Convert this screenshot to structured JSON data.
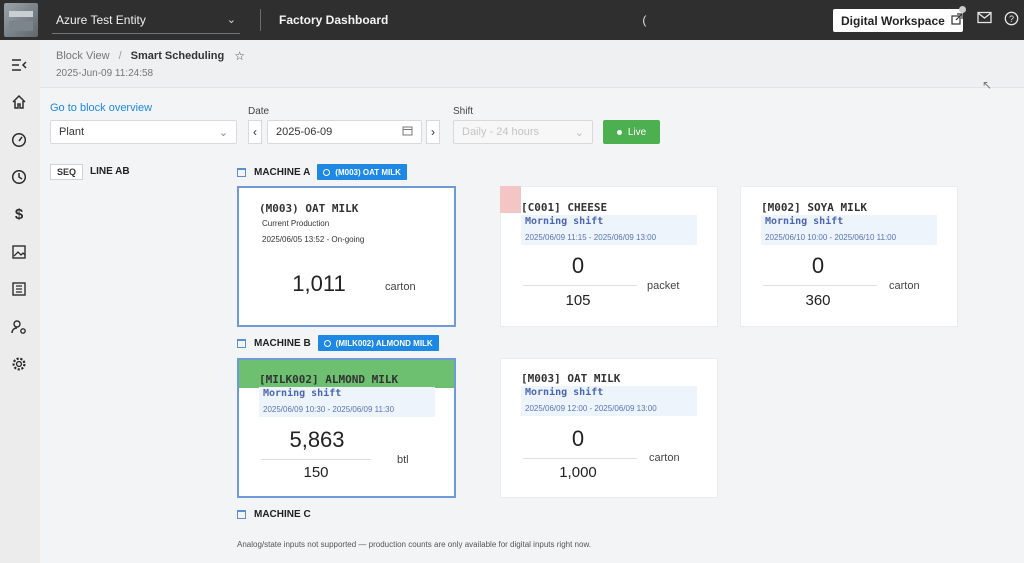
{
  "topbar": {
    "entity": "Azure Test Entity",
    "app_title": "Factory Dashboard",
    "stray_char": "(",
    "digital_workspace": "Digital Workspace"
  },
  "icons": {
    "sidebar": [
      "menu-collapse-icon",
      "home-icon",
      "speedometer-icon",
      "clock-icon",
      "dollar-icon",
      "image-icon",
      "report-icon",
      "user-settings-icon",
      "gear-icon"
    ]
  },
  "header": {
    "crumb_parent": "Block View",
    "crumb_separator": "/",
    "crumb_current": "Smart Scheduling",
    "timestamp": "2025-Jun-09 11:24:58"
  },
  "filters": {
    "block_link": "Go to block overview",
    "plant_value": "Plant",
    "date_label": "Date",
    "date_value": "2025-06-09",
    "shift_label": "Shift",
    "shift_placeholder": "Daily - 24 hours",
    "live_label": "Live"
  },
  "line": {
    "seq_label": "SEQ",
    "name": "LINE AB"
  },
  "machines": [
    {
      "name": "MACHINE A",
      "current_tag": "(M003) OAT MILK",
      "cards": [
        {
          "title": "(M003) OAT MILK",
          "subtitle": "Current Production",
          "status": "2025/06/05 13:52 - On-going",
          "actual": "1,011",
          "unit": "carton"
        },
        {
          "title": "[C001] CHEESE",
          "shift": "Morning shift",
          "range": "2025/06/09 11:15 - 2025/06/09 13:00",
          "actual": "0",
          "target": "105",
          "unit": "packet"
        },
        {
          "title": "[M002] SOYA MILK",
          "shift": "Morning shift",
          "range": "2025/06/10 10:00 - 2025/06/10 11:00",
          "actual": "0",
          "target": "360",
          "unit": "carton"
        }
      ]
    },
    {
      "name": "MACHINE B",
      "current_tag": "(MILK002) ALMOND MILK",
      "cards": [
        {
          "title": "[MILK002] ALMOND MILK",
          "shift": "Morning shift",
          "range": "2025/06/09 10:30 - 2025/06/09 11:30",
          "actual": "5,863",
          "target": "150",
          "unit": "btl"
        },
        {
          "title": "[M003] OAT MILK",
          "shift": "Morning shift",
          "range": "2025/06/09 12:00 - 2025/06/09 13:00",
          "actual": "0",
          "target": "1,000",
          "unit": "carton"
        }
      ]
    },
    {
      "name": "MACHINE C"
    }
  ],
  "footer_note": "Analog/state inputs not supported — production counts are only available for digital inputs right now."
}
